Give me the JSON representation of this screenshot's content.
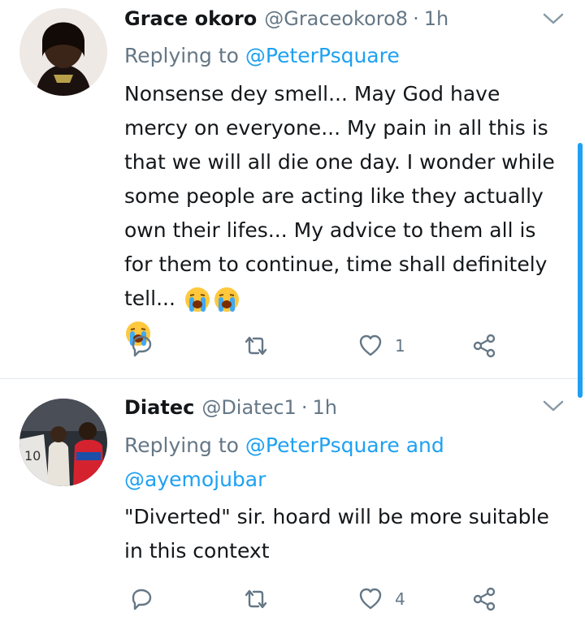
{
  "tweets": [
    {
      "name": "Grace okoro",
      "handle": "@Graceokoro8",
      "separator": "·",
      "time": "1h",
      "replying_prefix": "Replying to",
      "replying_to": [
        "@PeterPsquare"
      ],
      "replying_joiner": "",
      "text": "Nonsense dey smell...  May God have mercy on everyone... My pain in all this is that we will all die one day. I wonder while some people are acting like they actually own their lifes... My advice to them all is for them to continue, time shall definitely tell...",
      "emojis": [
        "loudly-crying-face",
        "loudly-crying-face",
        "loudly-crying-face"
      ],
      "reply_count": "",
      "retweet_count": "",
      "like_count": "1"
    },
    {
      "name": "Diatec",
      "handle": "@Diatec1",
      "separator": "·",
      "time": "1h",
      "replying_prefix": "Replying to",
      "replying_to": [
        "@PeterPsquare",
        "@ayemojubar"
      ],
      "replying_joiner": "and",
      "text": "\"Diverted\" sir. hoard will be more suitable in this context",
      "emojis": [],
      "reply_count": "",
      "retweet_count": "",
      "like_count": "4"
    }
  ],
  "colors": {
    "accent": "#1da1f2",
    "secondary_text": "#657786",
    "primary_text": "#14171a",
    "divider": "#e1e8ed"
  },
  "icons": [
    "chevron-down-icon",
    "reply-icon",
    "retweet-icon",
    "like-icon",
    "share-icon"
  ]
}
